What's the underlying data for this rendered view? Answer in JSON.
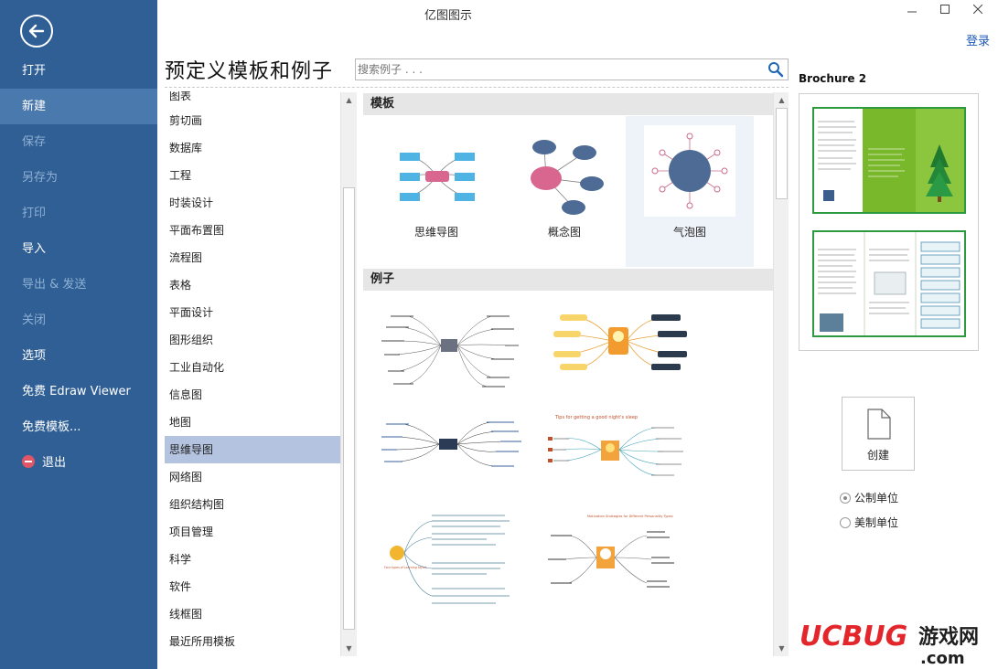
{
  "window": {
    "title": "亿图图示",
    "login": "登录"
  },
  "nav": {
    "items": [
      {
        "label": "打开",
        "state": "normal"
      },
      {
        "label": "新建",
        "state": "active"
      },
      {
        "label": "保存",
        "state": "disabled"
      },
      {
        "label": "另存为",
        "state": "disabled"
      },
      {
        "label": "打印",
        "state": "disabled"
      },
      {
        "label": "导入",
        "state": "normal"
      },
      {
        "label": "导出 & 发送",
        "state": "disabled"
      },
      {
        "label": "关闭",
        "state": "disabled"
      },
      {
        "label": "选项",
        "state": "normal"
      },
      {
        "label": "免费 Edraw Viewer",
        "state": "normal"
      },
      {
        "label": "免费模板...",
        "state": "normal"
      },
      {
        "label": "退出",
        "state": "normal"
      }
    ]
  },
  "header": {
    "title": "预定义模板和例子",
    "search_placeholder": "搜索例子 . . ."
  },
  "categories": {
    "items": [
      "图表",
      "剪切画",
      "数据库",
      "工程",
      "时装设计",
      "平面布置图",
      "流程图",
      "表格",
      "平面设计",
      "图形组织",
      "工业自动化",
      "信息图",
      "地图",
      "思维导图",
      "网络图",
      "组织结构图",
      "项目管理",
      "科学",
      "软件",
      "线框图",
      "最近所用模板"
    ],
    "selected": "思维导图"
  },
  "gallery": {
    "templates_heading": "模板",
    "templates": [
      "思维导图",
      "概念图",
      "气泡图"
    ],
    "examples_heading": "例子",
    "example_texts": {
      "ex4_title": "Tips for getting a good night's sleep",
      "ex6_title": "Motivation Strategies for Different Personality Types",
      "ex5_center": "Four types of Learning Styles"
    }
  },
  "preview": {
    "title": "Brochure 2",
    "create_label": "创建",
    "units": [
      {
        "label": "公制单位",
        "checked": true
      },
      {
        "label": "美制单位",
        "checked": false
      }
    ]
  },
  "watermark": {
    "brand": "UCBUG",
    "cn": "游戏网",
    "domain": ".com"
  },
  "colors": {
    "nav_bg": "#2f5f94",
    "nav_active": "#4a79ae",
    "selected_row": "#b4c4e0",
    "link": "#1f5ab8"
  }
}
